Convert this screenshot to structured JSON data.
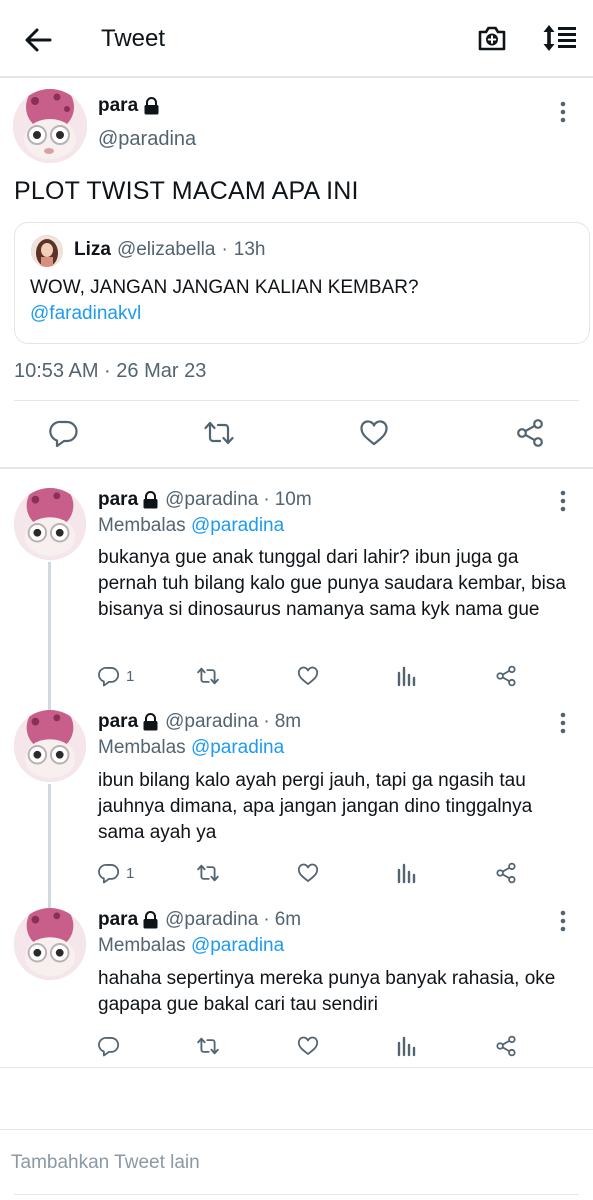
{
  "header": {
    "title": "Tweet",
    "back_icon": "arrow-left-icon",
    "camera_icon": "camera-plus-icon",
    "sort_icon": "sort-lines-icon"
  },
  "tweet": {
    "name": "para",
    "handle": "@paradina",
    "text": "PLOT TWIST MACAM APA INI",
    "timestamp": "10:53 AM · 26 Mar 23",
    "quote": {
      "name": "Liza",
      "handle": "@elizabella",
      "separator": "·",
      "time": "13h",
      "text": "WOW, JANGAN JANGAN KALIAN KEMBAR?",
      "mention": "@faradinakvl"
    },
    "actions": [
      "reply-icon",
      "retweet-icon",
      "like-icon",
      "share-icon"
    ]
  },
  "replies": [
    {
      "name": "para",
      "handle": "@paradina",
      "separator": "·",
      "time": "10m",
      "replying_prefix": "Membalas",
      "replying_to": "@paradina",
      "text": "bukanya gue anak tunggal dari lahir? ibun juga ga pernah tuh bilang kalo gue punya saudara kembar, bisa bisanya si dinosaurus namanya sama kyk nama gue",
      "reply_count": "1"
    },
    {
      "name": "para",
      "handle": "@paradina",
      "separator": "·",
      "time": "8m",
      "replying_prefix": "Membalas",
      "replying_to": "@paradina",
      "text": "ibun bilang kalo ayah pergi jauh, tapi ga ngasih tau jauhnya dimana, apa jangan jangan dino tinggalnya sama ayah ya",
      "reply_count": "1"
    },
    {
      "name": "para",
      "handle": "@paradina",
      "separator": "·",
      "time": "6m",
      "replying_prefix": "Membalas",
      "replying_to": "@paradina",
      "text": "hahaha sepertinya mereka punya banyak rahasia, oke gapapa gue bakal cari tau sendiri",
      "reply_count": ""
    }
  ],
  "compose": {
    "placeholder": "Tambahkan Tweet lain"
  },
  "colors": {
    "accent": "#1d9bf0",
    "secondary_text": "#536471",
    "divider": "#e6e6e6"
  }
}
